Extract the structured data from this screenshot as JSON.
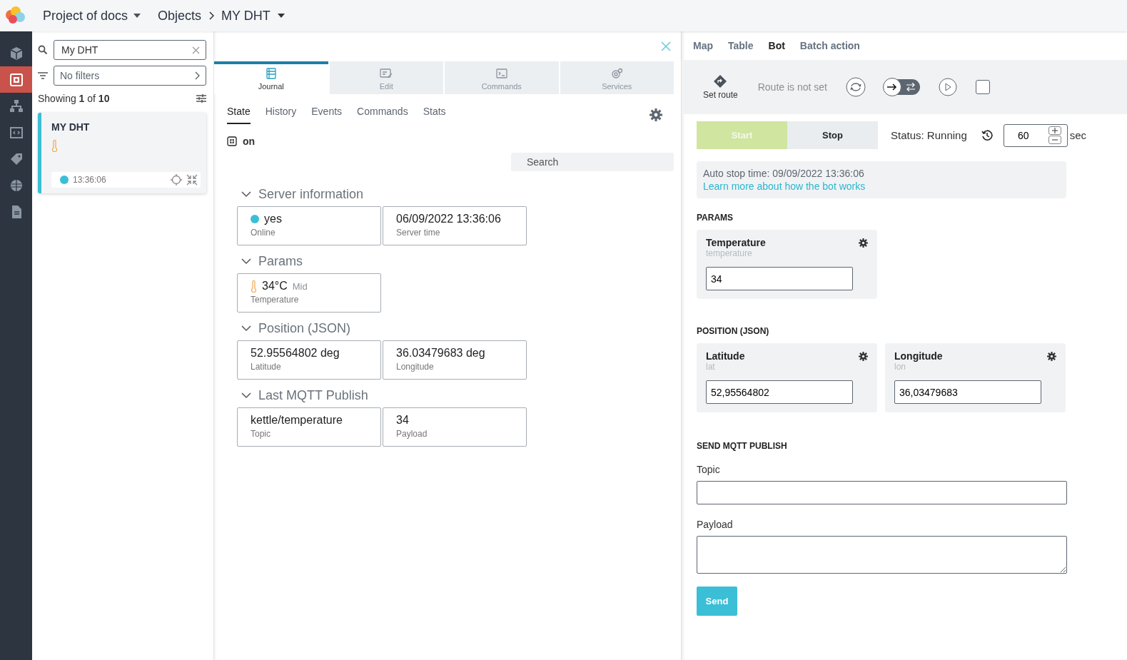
{
  "header": {
    "project": "Project of docs",
    "breadcrumbs": [
      "Objects",
      "MY DHT"
    ]
  },
  "rail": [
    {
      "selected": false
    },
    {
      "selected": true
    },
    {
      "selected": false
    },
    {
      "selected": false
    },
    {
      "selected": false
    },
    {
      "selected": false
    },
    {
      "selected": false
    }
  ],
  "sidebar": {
    "search": "My DHT",
    "filter": "No filters",
    "showing": "Showing **1** of **10**",
    "objects": [
      {
        "name": "MY DHT",
        "time": "13:36:06",
        "online": true,
        "selected": true
      }
    ]
  },
  "object_panel": {
    "tabs": [
      {
        "label": "Journal",
        "selected": true
      },
      {
        "label": "Edit",
        "selected": false
      },
      {
        "label": "Commands",
        "selected": false
      },
      {
        "label": "Services",
        "selected": false
      }
    ],
    "subtabs": [
      {
        "label": "State",
        "selected": true
      },
      {
        "label": "History",
        "selected": false
      },
      {
        "label": "Events",
        "selected": false
      },
      {
        "label": "Commands",
        "selected": false
      },
      {
        "label": "Stats",
        "selected": false
      }
    ],
    "state_value": "on",
    "search": {
      "placeholder": "Search"
    },
    "sections": [
      {
        "title": "Server information",
        "expanded": true,
        "cards": [
          {
            "kind": "status",
            "value": "yes",
            "label": "Online"
          },
          {
            "kind": "plain",
            "value": "06/09/2022 13:36:06",
            "label": "Server time"
          }
        ]
      },
      {
        "title": "Params",
        "expanded": true,
        "cards": [
          {
            "kind": "sensor",
            "value": "34°C",
            "note": "Mid",
            "label": "Temperature"
          }
        ]
      },
      {
        "title": "Position (JSON)",
        "expanded": true,
        "cards": [
          {
            "kind": "plain",
            "value": "52.95564802 deg",
            "label": "Latitude"
          },
          {
            "kind": "plain",
            "value": "36.03479683 deg",
            "label": "Longitude"
          }
        ]
      },
      {
        "title": "Last MQTT Publish",
        "expanded": true,
        "cards": [
          {
            "kind": "plain",
            "value": "kettle/temperature",
            "label": "Topic"
          },
          {
            "kind": "plain",
            "value": "34",
            "label": "Payload"
          }
        ]
      }
    ]
  },
  "bot_panel": {
    "tabs": [
      {
        "label": "Map",
        "selected": false
      },
      {
        "label": "Table",
        "selected": false
      },
      {
        "label": "Bot",
        "selected": true
      },
      {
        "label": "Batch action",
        "selected": false
      }
    ],
    "set_route": "Set route",
    "round_trip": {
      "on": true
    },
    "repeat": {
      "checked": false
    },
    "route_status": "Route is not set",
    "start": {
      "label": "Start",
      "disabled": true
    },
    "stop": {
      "label": "Stop",
      "disabled": false
    },
    "status": "Status: Running",
    "interval": "60",
    "interval_unit": "sec",
    "info": "Auto stop time: 09/09/2022 13:36:06",
    "info_link": "Learn more about how the bot works",
    "groups": [
      {
        "title": "PARAMS",
        "fields": [
          {
            "label": "Temperature",
            "key": "temperature",
            "value": "34"
          }
        ]
      },
      {
        "title": "POSITION (JSON)",
        "fields": [
          {
            "label": "Latitude",
            "key": "lat",
            "value": "52,95564802"
          },
          {
            "label": "Longitude",
            "key": "lon",
            "value": "36,03479683"
          }
        ]
      }
    ],
    "mqtt": {
      "title": "SEND MQTT PUBLISH",
      "topic_label": "Topic",
      "payload_label": "Payload",
      "send": "Send"
    }
  }
}
